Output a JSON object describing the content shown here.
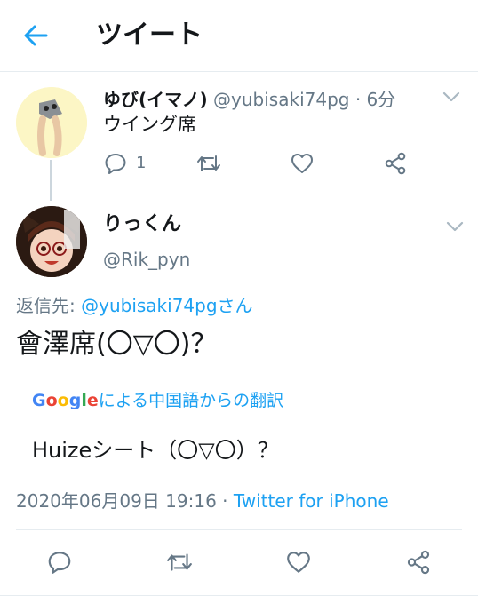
{
  "header": {
    "title": "ツイート"
  },
  "parent_tweet": {
    "name": "ゆび(イマノ)",
    "handle": "@yubisaki74pg",
    "separator": "·",
    "time": "6分",
    "text": "ウイング席",
    "reply_count": "1"
  },
  "reply_tweet": {
    "name": "りっくん",
    "handle": "@Rik_pyn",
    "reply_to_prefix": "返信先: ",
    "reply_to_mention": "@yubisaki74pgさん",
    "text": "會澤席(〇▽〇)？",
    "translate_label": "による中国語からの翻訳",
    "translated_text": "Huizeシート（〇▽〇）？",
    "timestamp": "2020年06月09日 19:16",
    "via_separator": " · ",
    "via": "Twitter for iPhone"
  },
  "google_logo": [
    "G",
    "o",
    "o",
    "g",
    "l",
    "e"
  ],
  "colors": {
    "accent": "#1da1f2",
    "secondary_text": "#657786",
    "divider": "#e6ecf0"
  },
  "icons": {
    "back": "arrow-left-icon",
    "reply": "comment-icon",
    "retweet": "retweet-icon",
    "like": "heart-icon",
    "share": "share-icon",
    "more": "chevron-down-icon"
  }
}
